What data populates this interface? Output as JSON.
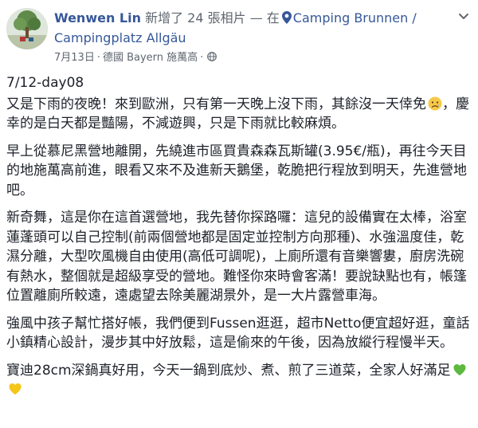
{
  "post": {
    "author": "Wenwen Lin",
    "action": " 新增了 24 張相片 — 在",
    "place": "Camping Brunnen / Campingplatz Allgäu",
    "date": "7月13日",
    "location": "德國 Bayern 施萬高",
    "separator": "·",
    "title": "7/12-day08",
    "paragraphs": [
      "又是下雨的夜晚！來到歐洲，只有第一天晚上沒下雨，其餘沒一天倖免",
      "早上從慕尼黑營地離開，先繞進市區買貴森森瓦斯罐(3.95€/瓶)，再往今天目的地施萬高前進，眼看又來不及進新天鵝堡，乾脆把行程放到明天，先進營地吧。",
      "新奇舞，這是你在這首選營地，我先替你探路囉：這兒的設備實在太棒，浴室蓮蓬頭可以自己控制(前兩個營地都是固定並控制方向那種)、水強溫度佳，乾濕分離，大型吹風機自由使用(高低可調呢)，上廁所還有音樂響婁，廚房洗碗有熱水，整個就是超級享受的營地。難怪你來時會客滿！要說缺點也有，帳篷位置離廁所較遠，遠處望去除美麗湖景外，是一大片露營車海。",
      "強風中孩子幫忙搭好帳，我們便到Fussen逛逛，超市Netto便宜超好逛，童話小鎮精心設計，漫步其中好放鬆，這是偷來的午後，因為放縱行程慢半天。",
      "寶迪28cm深鍋真好用，今天一鍋到底炒、煮、煎了三道菜，全家人好滿足"
    ],
    "p1_tail": "，慶幸的是白天都是豔陽，不減遊興，只是下雨就比較麻煩。",
    "icons": {
      "avatar": "tree-avatar",
      "pin": "location-pin-icon",
      "globe": "globe-icon",
      "menu": "chevron-down-icon",
      "emoji_sad": "sad-face-emoji",
      "emoji_green_heart": "green-heart-emoji",
      "emoji_yellow_heart": "yellow-heart-emoji"
    },
    "colors": {
      "link": "#365899",
      "meta": "#606770",
      "text": "#1d2129"
    }
  }
}
